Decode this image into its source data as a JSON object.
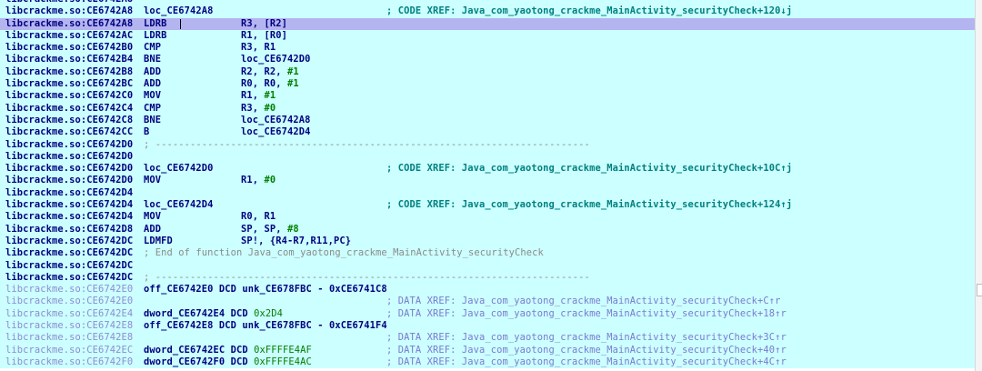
{
  "rows": [
    {
      "addr": "libcrackme.so:CE6742A8",
      "kind": "blank"
    },
    {
      "addr": "libcrackme.so:CE6742A8",
      "kind": "label",
      "text": "loc_CE6742A8",
      "xref": "; CODE XREF: Java_com_yaotong_crackme_MainActivity_securityCheck+120↓j"
    },
    {
      "addr": "libcrackme.so:CE6742A8",
      "kind": "insn",
      "mn": "LDRB",
      "ops": [
        "R3, [R2]"
      ],
      "selected": true
    },
    {
      "addr": "libcrackme.so:CE6742AC",
      "kind": "insn",
      "mn": "LDRB",
      "ops": [
        "R1, [R0]"
      ]
    },
    {
      "addr": "libcrackme.so:CE6742B0",
      "kind": "insn",
      "mn": "CMP",
      "ops": [
        "R3, R1"
      ]
    },
    {
      "addr": "libcrackme.so:CE6742B4",
      "kind": "insn",
      "mn": "BNE",
      "ops": [
        "loc_CE6742D0"
      ]
    },
    {
      "addr": "libcrackme.so:CE6742B8",
      "kind": "insn",
      "mn": "ADD",
      "ops": [
        "R2, R2, ",
        "#1"
      ]
    },
    {
      "addr": "libcrackme.so:CE6742BC",
      "kind": "insn",
      "mn": "ADD",
      "ops": [
        "R0, R0, ",
        "#1"
      ]
    },
    {
      "addr": "libcrackme.so:CE6742C0",
      "kind": "insn",
      "mn": "MOV",
      "ops": [
        "R1, ",
        "#1"
      ]
    },
    {
      "addr": "libcrackme.so:CE6742C4",
      "kind": "insn",
      "mn": "CMP",
      "ops": [
        "R3, ",
        "#0"
      ]
    },
    {
      "addr": "libcrackme.so:CE6742C8",
      "kind": "insn",
      "mn": "BNE",
      "ops": [
        "loc_CE6742A8"
      ]
    },
    {
      "addr": "libcrackme.so:CE6742CC",
      "kind": "insn",
      "mn": "B",
      "ops": [
        "loc_CE6742D4"
      ]
    },
    {
      "addr": "libcrackme.so:CE6742D0",
      "kind": "sep",
      "text": "; ---------------------------------------------------------------------------"
    },
    {
      "addr": "libcrackme.so:CE6742D0",
      "kind": "blank"
    },
    {
      "addr": "libcrackme.so:CE6742D0",
      "kind": "label",
      "text": "loc_CE6742D0",
      "xref": "; CODE XREF: Java_com_yaotong_crackme_MainActivity_securityCheck+10C↑j"
    },
    {
      "addr": "libcrackme.so:CE6742D0",
      "kind": "insn",
      "mn": "MOV",
      "ops": [
        "R1, ",
        "#0"
      ]
    },
    {
      "addr": "libcrackme.so:CE6742D4",
      "kind": "blank"
    },
    {
      "addr": "libcrackme.so:CE6742D4",
      "kind": "label",
      "text": "loc_CE6742D4",
      "xref": "; CODE XREF: Java_com_yaotong_crackme_MainActivity_securityCheck+124↑j"
    },
    {
      "addr": "libcrackme.so:CE6742D4",
      "kind": "insn",
      "mn": "MOV",
      "ops": [
        "R0, R1"
      ]
    },
    {
      "addr": "libcrackme.so:CE6742D8",
      "kind": "insn",
      "mn": "ADD",
      "ops": [
        "SP, SP, ",
        "#8"
      ]
    },
    {
      "addr": "libcrackme.so:CE6742DC",
      "kind": "insn",
      "mn": "LDMFD",
      "ops": [
        "SP!, {R4-R7,R11,PC}"
      ]
    },
    {
      "addr": "libcrackme.so:CE6742DC",
      "kind": "fnend",
      "text": "; End of function Java_com_yaotong_crackme_MainActivity_securityCheck"
    },
    {
      "addr": "libcrackme.so:CE6742DC",
      "kind": "blank"
    },
    {
      "addr": "libcrackme.so:CE6742DC",
      "kind": "sep",
      "text": "; ---------------------------------------------------------------------------"
    },
    {
      "addr": "libcrackme.so:CE6742E0",
      "kind": "data",
      "dim": true,
      "name": "off_CE6742E0 DCD unk_CE678FBC - 0xCE6741C8"
    },
    {
      "addr": "libcrackme.so:CE6742E0",
      "kind": "xrefonly",
      "dim": true,
      "xref": "; DATA XREF: Java_com_yaotong_crackme_MainActivity_securityCheck+C↑r"
    },
    {
      "addr": "libcrackme.so:CE6742E4",
      "kind": "dword",
      "dim": true,
      "name": "dword_CE6742E4 DCD ",
      "value": "0x2D4",
      "xref": "; DATA XREF: Java_com_yaotong_crackme_MainActivity_securityCheck+18↑r"
    },
    {
      "addr": "libcrackme.so:CE6742E8",
      "kind": "data",
      "dim": true,
      "name": "off_CE6742E8 DCD unk_CE678FBC - 0xCE6741F4"
    },
    {
      "addr": "libcrackme.so:CE6742E8",
      "kind": "xrefonly",
      "dim": true,
      "xref": "; DATA XREF: Java_com_yaotong_crackme_MainActivity_securityCheck+3C↑r"
    },
    {
      "addr": "libcrackme.so:CE6742EC",
      "kind": "dword",
      "dim": true,
      "name": "dword_CE6742EC DCD ",
      "value": "0xFFFFE4AF",
      "xref": "; DATA XREF: Java_com_yaotong_crackme_MainActivity_securityCheck+40↑r"
    },
    {
      "addr": "libcrackme.so:CE6742F0",
      "kind": "dword",
      "dim": true,
      "name": "dword_CE6742F0 DCD ",
      "value": "0xFFFFE4AC",
      "xref": "; DATA XREF: Java_com_yaotong_crackme_MainActivity_securityCheck+4C↑r"
    }
  ]
}
